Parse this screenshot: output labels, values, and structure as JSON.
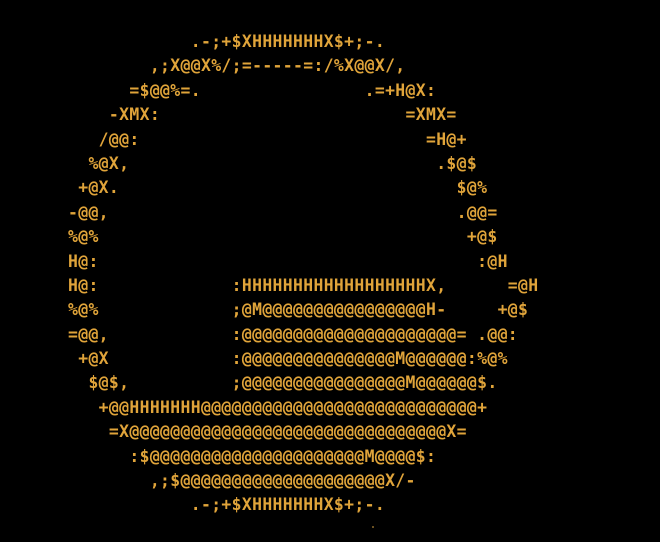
{
  "ascii_art": {
    "lines": [
      "            .-;+$XHHHHHHHX$+;-.",
      "        ,;X@@X%/;=-----=:/%X@@X/,",
      "      =$@@%=.                .=+H@X:",
      "    -XMX:                        =XMX=",
      "   /@@:                            =H@+",
      "  %@X,                              .$@$",
      " +@X.                                 $@%",
      "-@@,                                  .@@=",
      "%@%                                    +@$",
      "H@:                                     :@H",
      "H@:             :HHHHHHHHHHHHHHHHHHX,      =@H",
      "%@%             ;@M@@@@@@@@@@@@@@@@H-     +@$",
      "=@@,            :@@@@@@@@@@@@@@@@@@@@@= .@@:",
      " +@X            :@@@@@@@@@@@@@@@M@@@@@@:%@%",
      "  $@$,          ;@@@@@@@@@@@@@@@@M@@@@@@$.",
      "   +@@HHHHHHH@@@@@@@@@@@@@@@@@@@@@@@@@@@+",
      "    =X@@@@@@@@@@@@@@@@@@@@@@@@@@@@@@@X=",
      "      :$@@@@@@@@@@@@@@@@@@@@@M@@@@$:",
      "        ,;$@@@@@@@@@@@@@@@@@@@@X/-",
      "            .-;+$XHHHHHHHX$+;-."
    ],
    "text_color": "#e0a43a",
    "background_color": "#000000"
  }
}
